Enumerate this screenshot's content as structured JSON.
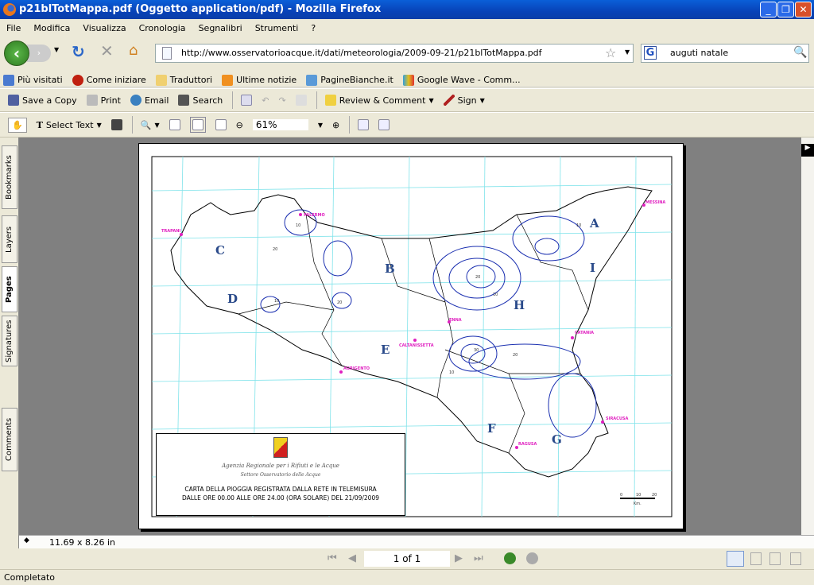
{
  "window": {
    "title": "p21blTotMappa.pdf (Oggetto application/pdf) - Mozilla Firefox",
    "buttons": [
      "_",
      "❐",
      "✕"
    ]
  },
  "menu": [
    "File",
    "Modifica",
    "Visualizza",
    "Cronologia",
    "Segnalibri",
    "Strumenti",
    "?"
  ],
  "nav": {
    "url": "http://www.osservatorioacque.it/dati/meteorologia/2009-09-21/p21blTotMappa.pdf",
    "search_value": "auguti natale",
    "search_engine": "G"
  },
  "bookmarks": [
    "Più visitati",
    "Come iniziare",
    "Traduttori",
    "Ultime notizie",
    "PagineBianche.it",
    "Google Wave - Comm..."
  ],
  "toolbar1": {
    "save": "Save a Copy",
    "print": "Print",
    "email": "Email",
    "search": "Search",
    "review": "Review & Comment",
    "sign": "Sign"
  },
  "toolbar2": {
    "select_text": "Select Text",
    "zoom": "61%"
  },
  "sidetabs": [
    "Bookmarks",
    "Layers",
    "Pages",
    "Signatures",
    "Comments"
  ],
  "map": {
    "regions": [
      "A",
      "B",
      "C",
      "D",
      "E",
      "F",
      "G",
      "H",
      "I"
    ],
    "cities": [
      "TRAPANI",
      "PALERMO",
      "MESSINA",
      "CATANIA",
      "ENNA",
      "CALTANISSETTA",
      "AGRIGENTO",
      "SIRACUSA",
      "RAGUSA"
    ],
    "contour_labels": [
      "10",
      "20",
      "10",
      "20",
      "10",
      "20",
      "30",
      "10",
      "20",
      "10"
    ],
    "agency": "Agenzia Regionale per i Rifiuti e le Acque",
    "office": "Settore Osservatorio delle Acque",
    "caption1": "CARTA DELLA PIOGGIA REGISTRATA DALLA RETE IN TELEMISURA",
    "caption2": "DALLE ORE 00.00 ALLE ORE 24.00 (ORA SOLARE) DEL 21/09/2009",
    "scale": [
      "0",
      "10",
      "20"
    ],
    "scale_unit": "Km.",
    "colors": {
      "grid": "#7fe3ea",
      "coast": "#000000",
      "contour": "#1a2fb0",
      "city": "#e020c0"
    }
  },
  "page_size": "11.69 x 8.26 in",
  "pager": {
    "page": "1 of 1"
  },
  "status": "Completato"
}
